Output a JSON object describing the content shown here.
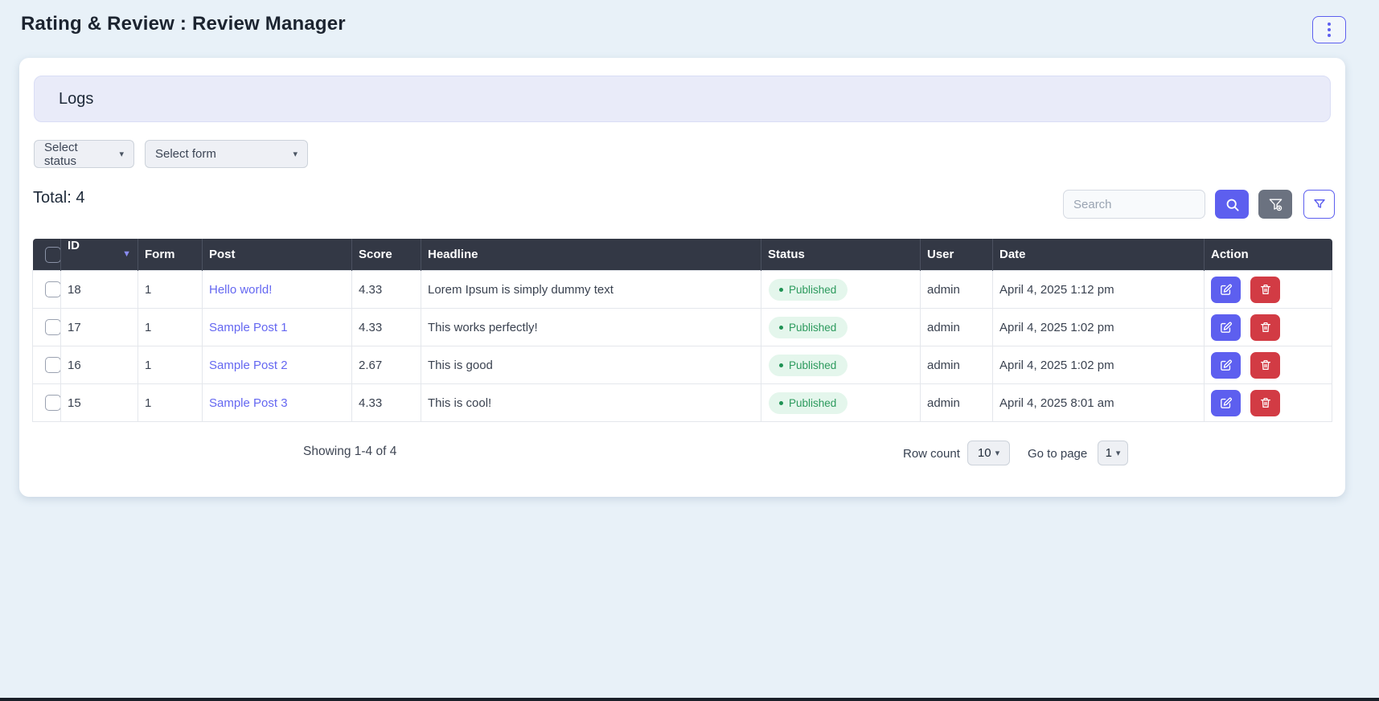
{
  "page": {
    "title": "Rating & Review : Review Manager"
  },
  "panel": {
    "heading": "Logs",
    "filters": {
      "status_dropdown": "Select status",
      "form_dropdown": "Select form"
    },
    "total_label": "Total: 4",
    "search": {
      "placeholder": "Search"
    }
  },
  "table": {
    "columns": [
      "ID",
      "Form",
      "Post",
      "Score",
      "Headline",
      "Status",
      "User",
      "Date",
      "Action"
    ],
    "rows": [
      {
        "id": "18",
        "form": "1",
        "post": "Hello world!",
        "score": "4.33",
        "headline": "Lorem Ipsum is simply dummy text",
        "status": "Published",
        "user": "admin",
        "date": "April 4, 2025 1:12 pm"
      },
      {
        "id": "17",
        "form": "1",
        "post": "Sample Post 1",
        "score": "4.33",
        "headline": "This works perfectly!",
        "status": "Published",
        "user": "admin",
        "date": "April 4, 2025 1:02 pm"
      },
      {
        "id": "16",
        "form": "1",
        "post": "Sample Post 2",
        "score": "2.67",
        "headline": "This is good",
        "status": "Published",
        "user": "admin",
        "date": "April 4, 2025 1:02 pm"
      },
      {
        "id": "15",
        "form": "1",
        "post": "Sample Post 3",
        "score": "4.33",
        "headline": "This is cool!",
        "status": "Published",
        "user": "admin",
        "date": "April 4, 2025 8:01 am"
      }
    ]
  },
  "footer": {
    "showing": "Showing 1-4 of 4",
    "row_count_label": "Row count",
    "row_count_value": "10",
    "go_to_page_label": "Go to page",
    "page_value": "1"
  },
  "colors": {
    "accent": "#5d5fef",
    "danger": "#d23b44",
    "link": "#6467f1",
    "page_bg": "#e8f1f8",
    "header_bg": "#333845",
    "success_bg": "#e4f6ec",
    "success_text": "#2c9a5d"
  }
}
